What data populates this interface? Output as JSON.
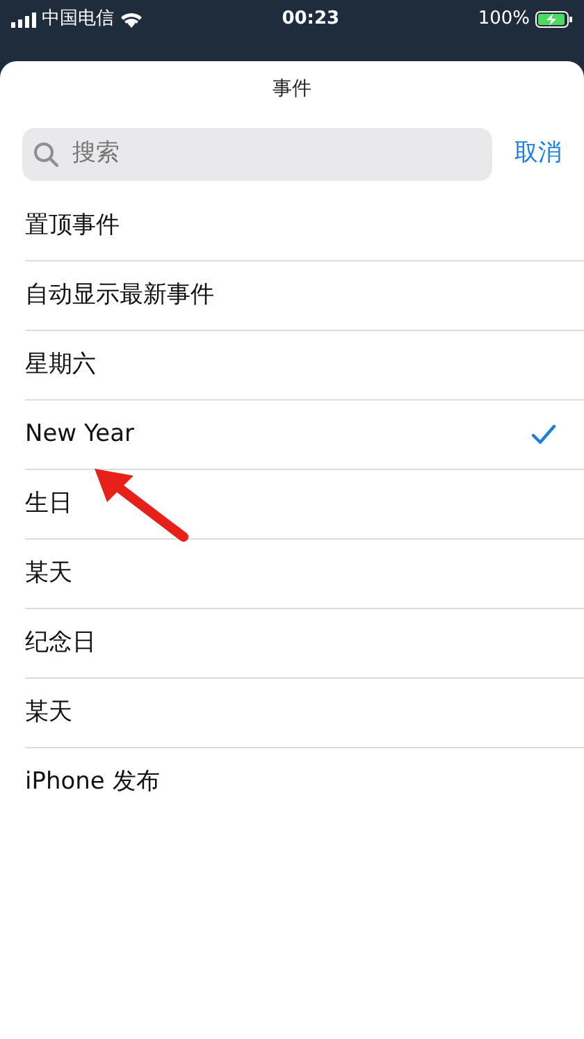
{
  "status_bar": {
    "carrier": "中国电信",
    "time": "00:23",
    "battery_text": "100%",
    "charging": true
  },
  "sheet": {
    "title": "事件"
  },
  "search": {
    "placeholder": "搜索",
    "cancel": "取消"
  },
  "items": [
    {
      "label": "置顶事件",
      "selected": false
    },
    {
      "label": "自动显示最新事件",
      "selected": false
    },
    {
      "label": "星期六",
      "selected": false
    },
    {
      "label": "New Year",
      "selected": true
    },
    {
      "label": "生日",
      "selected": false
    },
    {
      "label": "某天",
      "selected": false
    },
    {
      "label": "纪念日",
      "selected": false
    },
    {
      "label": "某天",
      "selected": false
    },
    {
      "label": "iPhone 发布",
      "selected": false
    }
  ],
  "annotations": [
    {
      "kind": "arrow"
    }
  ]
}
